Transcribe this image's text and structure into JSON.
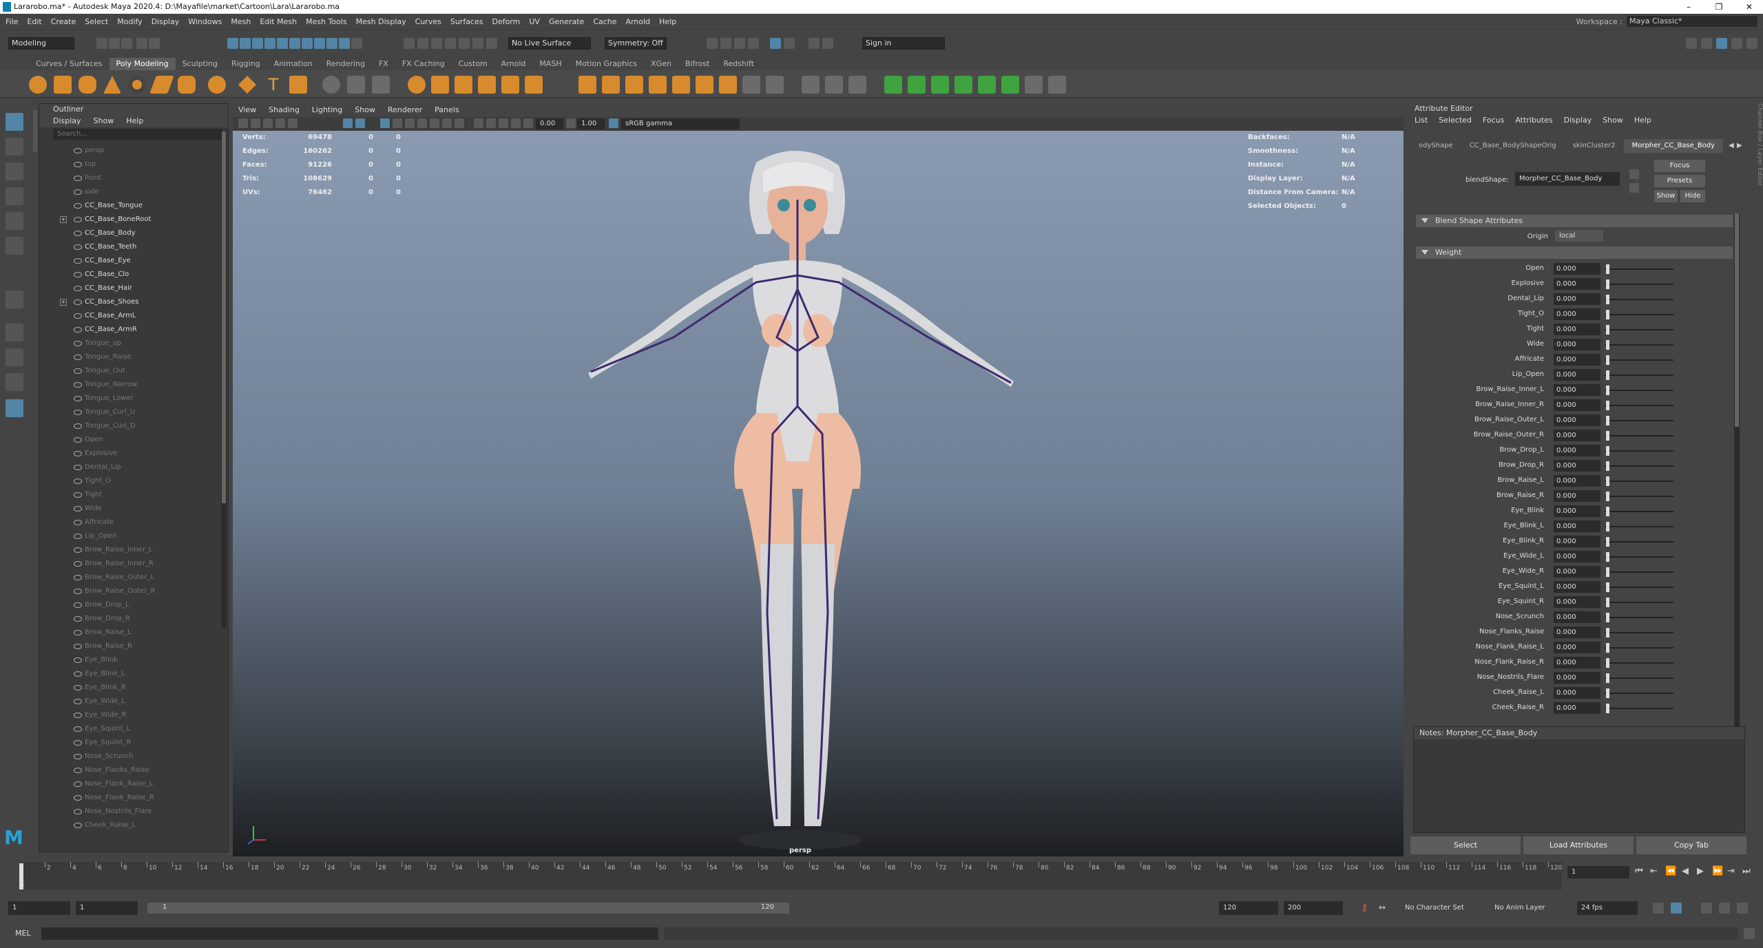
{
  "window": {
    "title": "Lararobo.ma* - Autodesk Maya 2020.4: D:\\Mayafile\\market\\Cartoon\\Lara\\Lararobo.ma"
  },
  "menubar": [
    "File",
    "Edit",
    "Create",
    "Select",
    "Modify",
    "Display",
    "Windows",
    "Mesh",
    "Edit Mesh",
    "Mesh Tools",
    "Mesh Display",
    "Curves",
    "Surfaces",
    "Deform",
    "UV",
    "Generate",
    "Cache",
    "Arnold",
    "Help"
  ],
  "workspace": {
    "label": "Workspace :",
    "value": "Maya Classic*"
  },
  "status": {
    "mode": "Modeling",
    "live_surface": "No Live Surface",
    "symmetry": "Symmetry: Off",
    "signin": "Sign in"
  },
  "shelf_tabs": [
    "Curves / Surfaces",
    "Poly Modeling",
    "Sculpting",
    "Rigging",
    "Animation",
    "Rendering",
    "FX",
    "FX Caching",
    "Custom",
    "Arnold",
    "MASH",
    "Motion Graphics",
    "XGen",
    "Bifrost",
    "Redshift"
  ],
  "outliner": {
    "title": "Outliner",
    "menu": [
      "Display",
      "Show",
      "Help"
    ],
    "search_placeholder": "Search...",
    "items": [
      {
        "label": "persp",
        "dim": true
      },
      {
        "label": "top",
        "dim": true
      },
      {
        "label": "front",
        "dim": true
      },
      {
        "label": "side",
        "dim": true
      },
      {
        "label": "CC_Base_Tongue",
        "dim": false
      },
      {
        "label": "CC_Base_BoneRoot",
        "dim": false
      },
      {
        "label": "CC_Base_Body",
        "dim": false
      },
      {
        "label": "CC_Base_Teeth",
        "dim": false
      },
      {
        "label": "CC_Base_Eye",
        "dim": false
      },
      {
        "label": "CC_Base_Clo",
        "dim": false
      },
      {
        "label": "CC_Base_Hair",
        "dim": false
      },
      {
        "label": "CC_Base_Shoes",
        "dim": false
      },
      {
        "label": "CC_Base_ArmL",
        "dim": false
      },
      {
        "label": "CC_Base_ArmR",
        "dim": false
      },
      {
        "label": "Tongue_up",
        "dim": true
      },
      {
        "label": "Tongue_Raise",
        "dim": true
      },
      {
        "label": "Tongue_Out",
        "dim": true
      },
      {
        "label": "Tongue_Narrow",
        "dim": true
      },
      {
        "label": "Tongue_Lower",
        "dim": true
      },
      {
        "label": "Tongue_Curl_U",
        "dim": true
      },
      {
        "label": "Tongue_Curl_D",
        "dim": true
      },
      {
        "label": "Open",
        "dim": true
      },
      {
        "label": "Explosive",
        "dim": true
      },
      {
        "label": "Dental_Lip",
        "dim": true
      },
      {
        "label": "Tight_O",
        "dim": true
      },
      {
        "label": "Tight",
        "dim": true
      },
      {
        "label": "Wide",
        "dim": true
      },
      {
        "label": "Affricate",
        "dim": true
      },
      {
        "label": "Lip_Open",
        "dim": true
      },
      {
        "label": "Brow_Raise_Inner_L",
        "dim": true
      },
      {
        "label": "Brow_Raise_Inner_R",
        "dim": true
      },
      {
        "label": "Brow_Raise_Outer_L",
        "dim": true
      },
      {
        "label": "Brow_Raise_Outer_R",
        "dim": true
      },
      {
        "label": "Brow_Drop_L",
        "dim": true
      },
      {
        "label": "Brow_Drop_R",
        "dim": true
      },
      {
        "label": "Brow_Raise_L",
        "dim": true
      },
      {
        "label": "Brow_Raise_R",
        "dim": true
      },
      {
        "label": "Eye_Blink",
        "dim": true
      },
      {
        "label": "Eye_Blink_L",
        "dim": true
      },
      {
        "label": "Eye_Blink_R",
        "dim": true
      },
      {
        "label": "Eye_Wide_L",
        "dim": true
      },
      {
        "label": "Eye_Wide_R",
        "dim": true
      },
      {
        "label": "Eye_Squint_L",
        "dim": true
      },
      {
        "label": "Eye_Squint_R",
        "dim": true
      },
      {
        "label": "Nose_Scrunch",
        "dim": true
      },
      {
        "label": "Nose_Flanks_Raise",
        "dim": true
      },
      {
        "label": "Nose_Flank_Raise_L",
        "dim": true
      },
      {
        "label": "Nose_Flank_Raise_R",
        "dim": true
      },
      {
        "label": "Nose_Nostrils_Flare",
        "dim": true
      },
      {
        "label": "Cheek_Raise_L",
        "dim": true
      }
    ]
  },
  "viewport": {
    "menu": [
      "View",
      "Shading",
      "Lighting",
      "Show",
      "Renderer",
      "Panels"
    ],
    "exposure": "0.00",
    "gamma": "1.00",
    "colorspace": "sRGB gamma",
    "camera_label": "persp",
    "hud_left": [
      {
        "label": "Verts:",
        "a": "69478",
        "b": "0",
        "c": "0"
      },
      {
        "label": "Edges:",
        "a": "160262",
        "b": "0",
        "c": "0"
      },
      {
        "label": "Faces:",
        "a": "91226",
        "b": "0",
        "c": "0"
      },
      {
        "label": "Tris:",
        "a": "108629",
        "b": "0",
        "c": "0"
      },
      {
        "label": "UVs:",
        "a": "76462",
        "b": "0",
        "c": "0"
      }
    ],
    "hud_right": [
      {
        "label": "Backfaces:",
        "value": "N/A"
      },
      {
        "label": "Smoothness:",
        "value": "N/A"
      },
      {
        "label": "Instance:",
        "value": "N/A"
      },
      {
        "label": "Display Layer:",
        "value": "N/A"
      },
      {
        "label": "Distance From Camera:",
        "value": "N/A"
      },
      {
        "label": "Selected Objects:",
        "value": "0"
      }
    ]
  },
  "attribute_editor": {
    "title": "Attribute Editor",
    "menu": [
      "List",
      "Selected",
      "Focus",
      "Attributes",
      "Display",
      "Show",
      "Help"
    ],
    "tabs": [
      "odyShape",
      "CC_Base_BodyShapeOrig",
      "skinCluster2",
      "Morpher_CC_Base_Body"
    ],
    "blendshape_label": "blendShape:",
    "blendshape_value": "Morpher_CC_Base_Body",
    "buttons": {
      "focus": "Focus",
      "presets": "Presets",
      "show": "Show",
      "hide": "Hide"
    },
    "section_blend": "Blend Shape Attributes",
    "origin_label": "Origin",
    "origin_value": "local",
    "section_weight": "Weight",
    "weights": [
      {
        "name": "Open",
        "value": "0.000"
      },
      {
        "name": "Explosive",
        "value": "0.000"
      },
      {
        "name": "Dental_Lip",
        "value": "0.000"
      },
      {
        "name": "Tight_O",
        "value": "0.000"
      },
      {
        "name": "Tight",
        "value": "0.000"
      },
      {
        "name": "Wide",
        "value": "0.000"
      },
      {
        "name": "Affricate",
        "value": "0.000"
      },
      {
        "name": "Lip_Open",
        "value": "0.000"
      },
      {
        "name": "Brow_Raise_Inner_L",
        "value": "0.000"
      },
      {
        "name": "Brow_Raise_Inner_R",
        "value": "0.000"
      },
      {
        "name": "Brow_Raise_Outer_L",
        "value": "0.000"
      },
      {
        "name": "Brow_Raise_Outer_R",
        "value": "0.000"
      },
      {
        "name": "Brow_Drop_L",
        "value": "0.000"
      },
      {
        "name": "Brow_Drop_R",
        "value": "0.000"
      },
      {
        "name": "Brow_Raise_L",
        "value": "0.000"
      },
      {
        "name": "Brow_Raise_R",
        "value": "0.000"
      },
      {
        "name": "Eye_Blink",
        "value": "0.000"
      },
      {
        "name": "Eye_Blink_L",
        "value": "0.000"
      },
      {
        "name": "Eye_Blink_R",
        "value": "0.000"
      },
      {
        "name": "Eye_Wide_L",
        "value": "0.000"
      },
      {
        "name": "Eye_Wide_R",
        "value": "0.000"
      },
      {
        "name": "Eye_Squint_L",
        "value": "0.000"
      },
      {
        "name": "Eye_Squint_R",
        "value": "0.000"
      },
      {
        "name": "Nose_Scrunch",
        "value": "0.000"
      },
      {
        "name": "Nose_Flanks_Raise",
        "value": "0.000"
      },
      {
        "name": "Nose_Flank_Raise_L",
        "value": "0.000"
      },
      {
        "name": "Nose_Flank_Raise_R",
        "value": "0.000"
      },
      {
        "name": "Nose_Nostrils_Flare",
        "value": "0.000"
      },
      {
        "name": "Cheek_Raise_L",
        "value": "0.000"
      },
      {
        "name": "Cheek_Raise_R",
        "value": "0.000"
      }
    ],
    "notes_label": "Notes:  Morpher_CC_Base_Body",
    "bottom_buttons": [
      "Select",
      "Load Attributes",
      "Copy Tab"
    ]
  },
  "timeline": {
    "ticks": [
      "2",
      "4",
      "6",
      "8",
      "10",
      "12",
      "14",
      "16",
      "18",
      "20",
      "22",
      "24",
      "26",
      "28",
      "30",
      "32",
      "34",
      "36",
      "38",
      "40",
      "42",
      "44",
      "46",
      "48",
      "50",
      "52",
      "54",
      "56",
      "58",
      "60",
      "62",
      "64",
      "66",
      "68",
      "70",
      "72",
      "74",
      "76",
      "78",
      "80",
      "82",
      "84",
      "86",
      "88",
      "90",
      "92",
      "94",
      "96",
      "98",
      "100",
      "102",
      "104",
      "106",
      "108",
      "110",
      "112",
      "114",
      "116",
      "118",
      "120"
    ],
    "current_frame": "1",
    "current_frame_field": "1"
  },
  "range": {
    "start": "1",
    "start2": "1",
    "slider_start": "1",
    "slider_end": "120",
    "end": "120",
    "end2": "200",
    "character_set": "No Character Set",
    "anim_layer": "No Anim Layer",
    "fps": "24 fps"
  },
  "command": {
    "lang": "MEL"
  }
}
